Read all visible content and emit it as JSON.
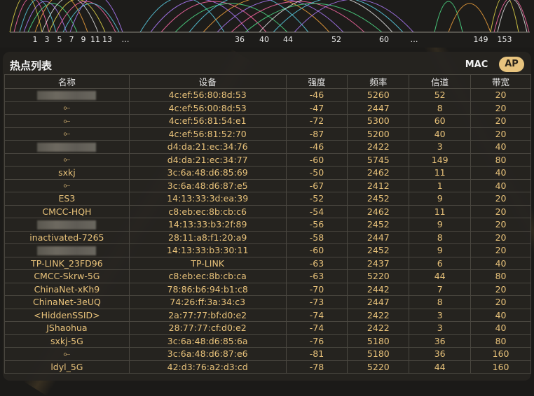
{
  "channel_axis": {
    "labels": [
      "1",
      "3",
      "5",
      "7",
      "9",
      "11",
      "13",
      "…",
      "36",
      "40",
      "44",
      "52",
      "60",
      "…",
      "149",
      "153"
    ]
  },
  "panel": {
    "title": "热点列表",
    "mode_mac": "MAC",
    "mode_ap": "AP"
  },
  "table": {
    "headers": [
      "名称",
      "设备",
      "强度",
      "频率",
      "信道",
      "带宽"
    ],
    "rows": [
      {
        "name": "",
        "hidden": true,
        "device": "4c:ef:56:80:8d:53",
        "strength": "-46",
        "freq": "5260",
        "channel": "52",
        "bw": "20"
      },
      {
        "name": "⟜",
        "hidden": false,
        "device": "4c:ef:56:00:8d:53",
        "strength": "-47",
        "freq": "2447",
        "channel": "8",
        "bw": "20"
      },
      {
        "name": "⟜",
        "hidden": false,
        "device": "4c:ef:56:81:54:e1",
        "strength": "-72",
        "freq": "5300",
        "channel": "60",
        "bw": "20"
      },
      {
        "name": "⟜",
        "hidden": false,
        "device": "4c:ef:56:81:52:70",
        "strength": "-87",
        "freq": "5200",
        "channel": "40",
        "bw": "20"
      },
      {
        "name": "",
        "hidden": true,
        "device": "d4:da:21:ec:34:76",
        "strength": "-46",
        "freq": "2422",
        "channel": "3",
        "bw": "40"
      },
      {
        "name": "⟜",
        "hidden": false,
        "device": "d4:da:21:ec:34:77",
        "strength": "-60",
        "freq": "5745",
        "channel": "149",
        "bw": "80"
      },
      {
        "name": "sxkj",
        "hidden": false,
        "device": "3c:6a:48:d6:85:69",
        "strength": "-50",
        "freq": "2462",
        "channel": "11",
        "bw": "40"
      },
      {
        "name": "⟜",
        "hidden": false,
        "device": "3c:6a:48:d6:87:e5",
        "strength": "-67",
        "freq": "2412",
        "channel": "1",
        "bw": "40"
      },
      {
        "name": "ES3",
        "hidden": false,
        "device": "14:13:33:3d:ea:39",
        "strength": "-52",
        "freq": "2452",
        "channel": "9",
        "bw": "20"
      },
      {
        "name": "CMCC-HQH",
        "hidden": false,
        "device": "c8:eb:ec:8b:cb:c6",
        "strength": "-54",
        "freq": "2462",
        "channel": "11",
        "bw": "20"
      },
      {
        "name": "",
        "hidden": true,
        "device": "14:13:33:b3:2f:89",
        "strength": "-56",
        "freq": "2452",
        "channel": "9",
        "bw": "20"
      },
      {
        "name": "inactivated-7265",
        "hidden": false,
        "device": "28:11:a8:f1:20:a9",
        "strength": "-58",
        "freq": "2447",
        "channel": "8",
        "bw": "20"
      },
      {
        "name": "",
        "hidden": true,
        "device": "14:13:33:b3:30:11",
        "strength": "-60",
        "freq": "2452",
        "channel": "9",
        "bw": "20"
      },
      {
        "name": "TP-LINK_23FD96",
        "hidden": false,
        "device": "TP-LINK",
        "strength": "-63",
        "freq": "2437",
        "channel": "6",
        "bw": "40"
      },
      {
        "name": "CMCC-Skrw-5G",
        "hidden": false,
        "device": "c8:eb:ec:8b:cb:ca",
        "strength": "-63",
        "freq": "5220",
        "channel": "44",
        "bw": "80"
      },
      {
        "name": "ChinaNet-xKh9",
        "hidden": false,
        "device": "78:86:b6:94:b1:c8",
        "strength": "-70",
        "freq": "2442",
        "channel": "7",
        "bw": "20"
      },
      {
        "name": "ChinaNet-3eUQ",
        "hidden": false,
        "device": "74:26:ff:3a:34:c3",
        "strength": "-73",
        "freq": "2447",
        "channel": "8",
        "bw": "20"
      },
      {
        "name": "<HiddenSSID>",
        "hidden": false,
        "device": "2a:77:77:bf:d0:e2",
        "strength": "-74",
        "freq": "2422",
        "channel": "3",
        "bw": "40"
      },
      {
        "name": "JShaohua",
        "hidden": false,
        "device": "28:77:77:cf:d0:e2",
        "strength": "-74",
        "freq": "2422",
        "channel": "3",
        "bw": "40"
      },
      {
        "name": "sxkj-5G",
        "hidden": false,
        "device": "3c:6a:48:d6:85:6a",
        "strength": "-76",
        "freq": "5180",
        "channel": "36",
        "bw": "80"
      },
      {
        "name": "⟜",
        "hidden": false,
        "device": "3c:6a:48:d6:87:e6",
        "strength": "-81",
        "freq": "5180",
        "channel": "36",
        "bw": "160"
      },
      {
        "name": "ldyl_5G",
        "hidden": false,
        "device": "42:d3:76:a2:d3:cd",
        "strength": "-78",
        "freq": "5220",
        "channel": "44",
        "bw": "160"
      }
    ]
  },
  "colors": {
    "accent": "#e8c47e",
    "cell_text": "#e8c27a",
    "header_text": "#e8e8e8",
    "graph_curves": [
      "#e6d94a",
      "#ff6aa8",
      "#5ad0e6",
      "#b07cff",
      "#4fe08a",
      "#f2a23c",
      "#e8e8e8"
    ]
  }
}
